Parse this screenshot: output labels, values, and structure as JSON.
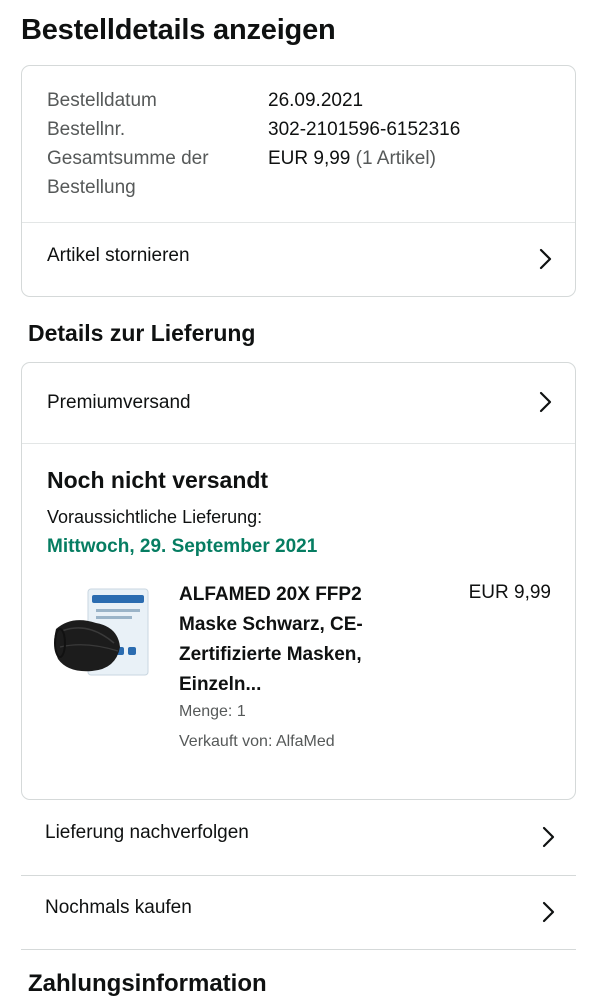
{
  "page": {
    "title": "Bestelldetails anzeigen"
  },
  "summary": {
    "order_date_label": "Bestelldatum",
    "order_date": "26.09.2021",
    "order_no_label": "Bestellnr.",
    "order_no": "302-2101596-6152316",
    "total_label_line1": "Gesamtsumme der",
    "total_label_line2": "Bestellung",
    "total_value": "EUR 9,99",
    "total_count": "(1 Artikel)",
    "cancel_label": "Artikel stornieren"
  },
  "delivery": {
    "section_title": "Details zur Lieferung",
    "shipping_method": "Premiumversand",
    "status": "Noch nicht versandt",
    "eta_label": "Voraussichtliche Lieferung:",
    "eta_date": "Mittwoch, 29. September 2021",
    "eta_color": "#067d62"
  },
  "product": {
    "title": "ALFAMED 20X FFP2 Maske Schwarz, CE-Zertifizierte Masken, Einzeln...",
    "price": "EUR 9,99",
    "quantity": "Menge: 1",
    "seller": "Verkauft von: AlfaMed",
    "image_icon": "mask-product-image"
  },
  "actions": {
    "track_label": "Lieferung nachverfolgen",
    "buy_again_label": "Nochmals kaufen"
  },
  "payment": {
    "section_title": "Zahlungsinformation"
  }
}
